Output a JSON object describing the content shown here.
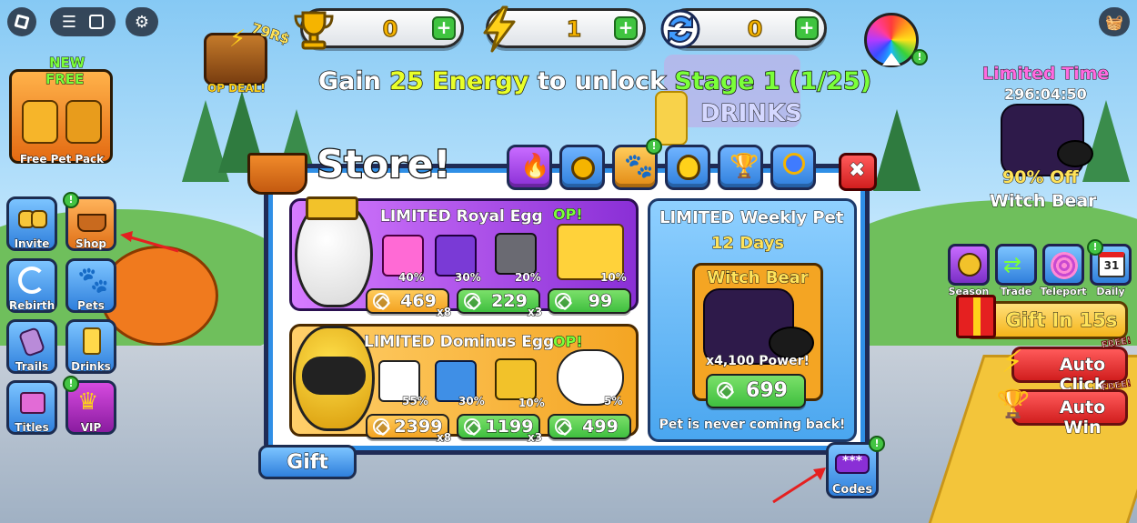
{
  "stats": {
    "trophies": "0",
    "energy": "1",
    "rebirths": "0"
  },
  "op_deal": {
    "price": "79R$",
    "label": "OP DEAL!"
  },
  "objective": {
    "prefix": "Gain ",
    "amount": "25 Energy",
    "middle": " to unlock ",
    "stage": "Stage 1 (1/25)"
  },
  "bg_sign": {
    "drinks": "DRINKS"
  },
  "free_pack": {
    "new_label": "NEW",
    "free_label": "FREE",
    "caption": "Free Pet Pack"
  },
  "left_menu": [
    {
      "label": "Invite",
      "icon": "invite-icon"
    },
    {
      "label": "Shop",
      "icon": "shop-basket-icon"
    },
    {
      "label": "Rebirth",
      "icon": "rebirth-icon"
    },
    {
      "label": "Pets",
      "icon": "paw-icon"
    },
    {
      "label": "Trails",
      "icon": "trails-icon"
    },
    {
      "label": "Drinks",
      "icon": "drinks-icon"
    },
    {
      "label": "Titles",
      "icon": "titles-icon"
    },
    {
      "label": "VIP",
      "icon": "crown-icon"
    }
  ],
  "store": {
    "title": "Store!",
    "tabs": [
      "fire-tab-icon",
      "robux-tab-icon",
      "paw-tab-icon",
      "potion-tab-icon",
      "trophy-tab-icon",
      "ribbon-tab-icon"
    ],
    "close_label": "✖",
    "royal_egg": {
      "title": "LIMITED Royal Egg",
      "op": "OP!",
      "chances": [
        "40%",
        "30%",
        "20%",
        "10%"
      ],
      "prices": [
        {
          "value": "469",
          "mult": "x8"
        },
        {
          "value": "229",
          "mult": "x3"
        },
        {
          "value": "99",
          "mult": ""
        }
      ]
    },
    "dominus_egg": {
      "title": "LIMITED Dominus Egg",
      "op": "OP!",
      "chances": [
        "55%",
        "30%",
        "10%",
        "5%"
      ],
      "prices": [
        {
          "value": "2399",
          "mult": "x8"
        },
        {
          "value": "1199",
          "mult": "x3"
        },
        {
          "value": "499",
          "mult": ""
        }
      ]
    },
    "weekly_pet": {
      "title": "LIMITED Weekly Pet",
      "days": "12 Days",
      "pet_name": "Witch Bear",
      "power": "x4,100 Power!",
      "price": "699",
      "footer": "Pet is never coming back!"
    },
    "gift_label": "Gift"
  },
  "codes": {
    "label": "Codes",
    "dots": "***"
  },
  "right_panel": {
    "limited_time": "Limited Time",
    "timer": "296:04:50",
    "discount": "90% Off",
    "pet_name": "Witch Bear",
    "buttons": [
      {
        "label": "Season",
        "icon": "season-icon"
      },
      {
        "label": "Trade",
        "icon": "trade-icon"
      },
      {
        "label": "Teleport",
        "icon": "teleport-icon"
      },
      {
        "label": "Daily",
        "icon": "calendar-icon",
        "day": "31"
      }
    ],
    "gift_in": "Gift In 15s",
    "auto_click": "Auto Click",
    "auto_win": "Auto Win",
    "free_tag": "FREE!"
  },
  "colors": {
    "energy_green": "#7bff3a",
    "stage_green": "#7bff3a",
    "store_blue": "#2f8fe6",
    "royal_purple": "#8a2fd6",
    "dominus_orange": "#f4a523",
    "price_green": "#3fbf3f",
    "price_orange": "#f3a322"
  }
}
